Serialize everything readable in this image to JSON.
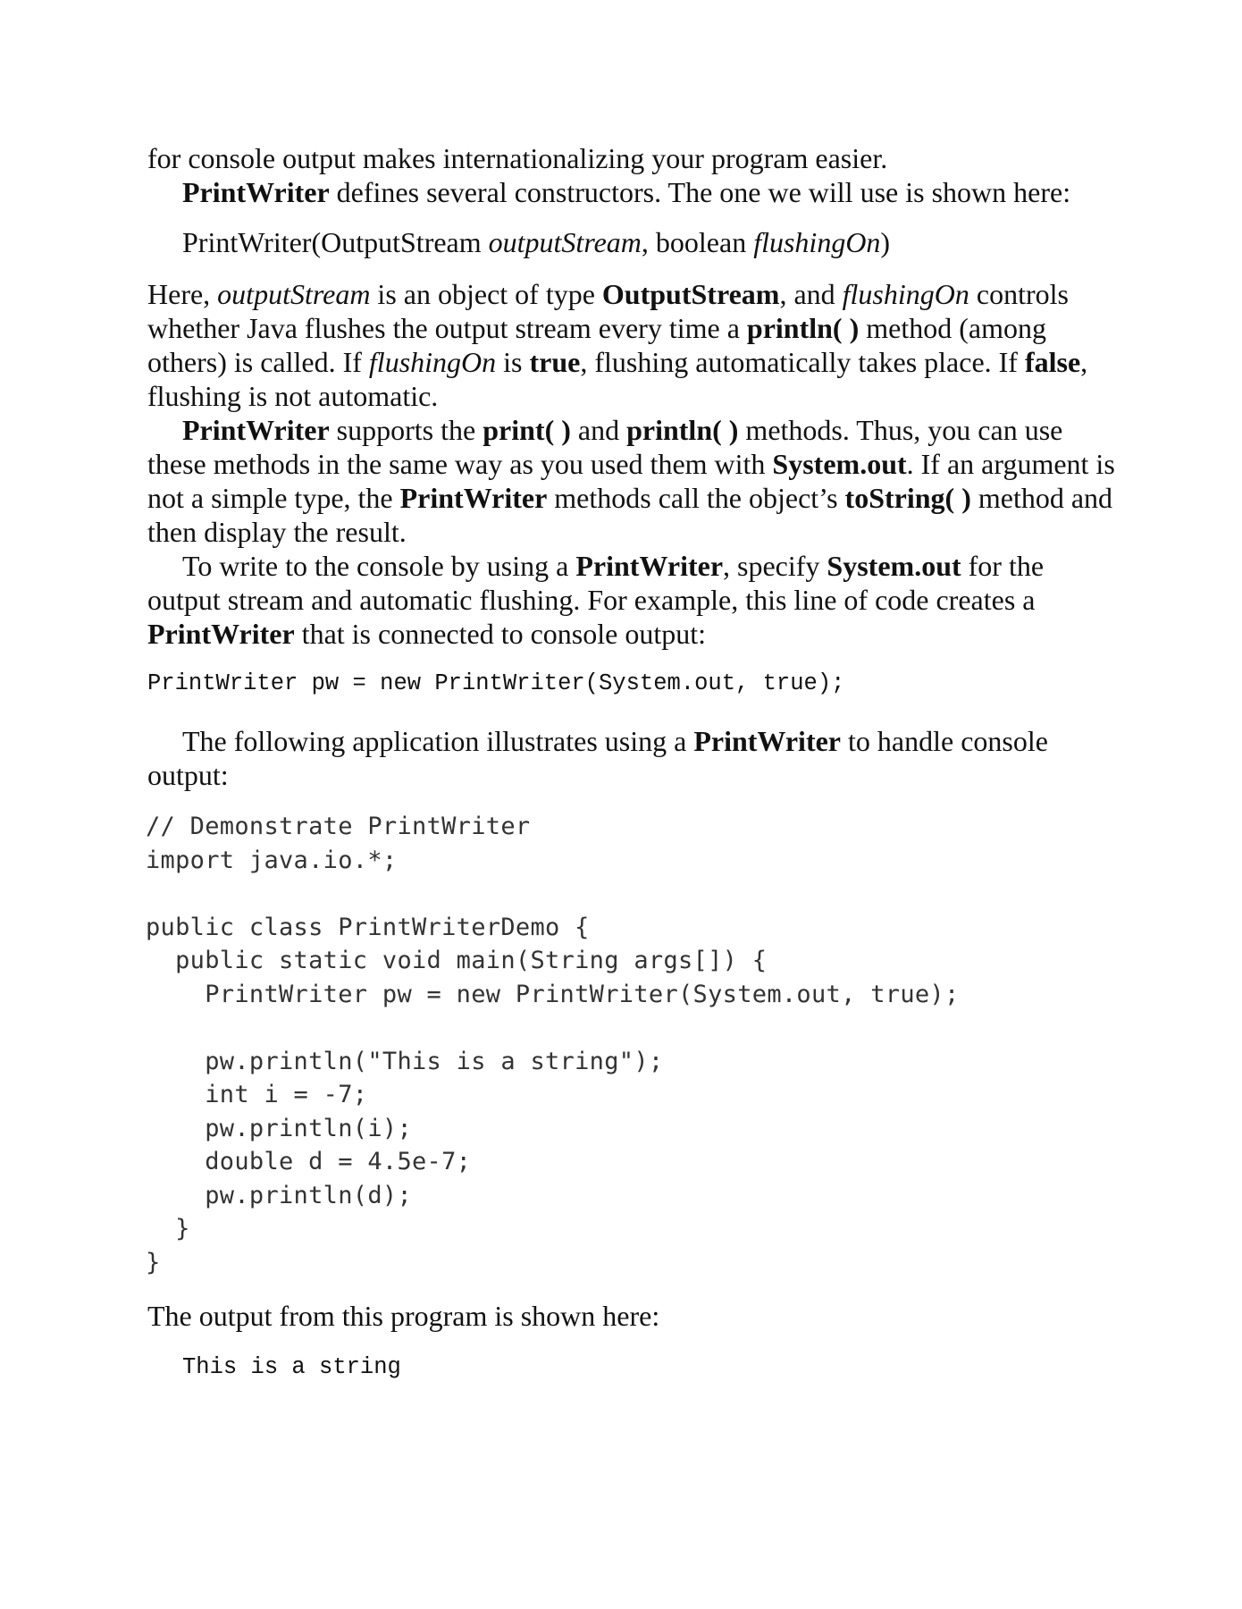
{
  "text": {
    "l0": "for console output makes internationalizing your program easier.",
    "pw": "PrintWriter",
    "p1_rest": " defines several constructors. The one we will use is shown here:",
    "ctor_a": "PrintWriter(OutputStream ",
    "ctor_b": "outputStream",
    "ctor_c": ", boolean ",
    "ctor_d": "flushingOn",
    "ctor_e": ")",
    "here": "Here, ",
    "outputStream": "outputStream",
    "is_obj": " is an object of type ",
    "OutputStream": "OutputStream",
    "and": ", and ",
    "flushingOn": "flushingOn",
    "controls": " controls whether Java flushes the output stream every time a ",
    "println": "println( )",
    "method_among": " method (among others) is called. If ",
    "flushingOn2": "flushingOn",
    "is": " is ",
    "true": "true",
    "flush_auto": ", flushing automatically takes place. If ",
    "false": "false",
    "flush_not": ", flushing is not automatic.",
    "supports": " supports the ",
    "print": "print( )",
    "and2": " and ",
    "println2": "println( )",
    "methods_thus": " methods. Thus, you can use these methods in the same way as you used them with ",
    "sysout": "System.out",
    "if_arg": ". If an argument is not a simple type, the ",
    "pw_methods": " methods call the object’s ",
    "toString": "toString( )",
    "method_disp": " method and then display the result.",
    "to_write": "To write to the console by using a ",
    "specify": ", specify ",
    "sysout2": "System.out",
    "for_the": " for the output stream and automatic flushing. For example, this line of code creates a ",
    "connected": " that is connected to console output:",
    "code_line": "PrintWriter pw = new PrintWriter(System.out, true);",
    "following": "The following application illustrates using a ",
    "to_handle": " to handle console output:",
    "program": "// Demonstrate PrintWriter\nimport java.io.*;\n\npublic class PrintWriterDemo {\n  public static void main(String args[]) {\n    PrintWriter pw = new PrintWriter(System.out, true);\n\n    pw.println(\"This is a string\");\n    int i = -7;\n    pw.println(i);\n    double d = 4.5e-7;\n    pw.println(d);\n  }\n}",
    "output_label": "The output from this program is shown here:",
    "output": "This is a string"
  }
}
